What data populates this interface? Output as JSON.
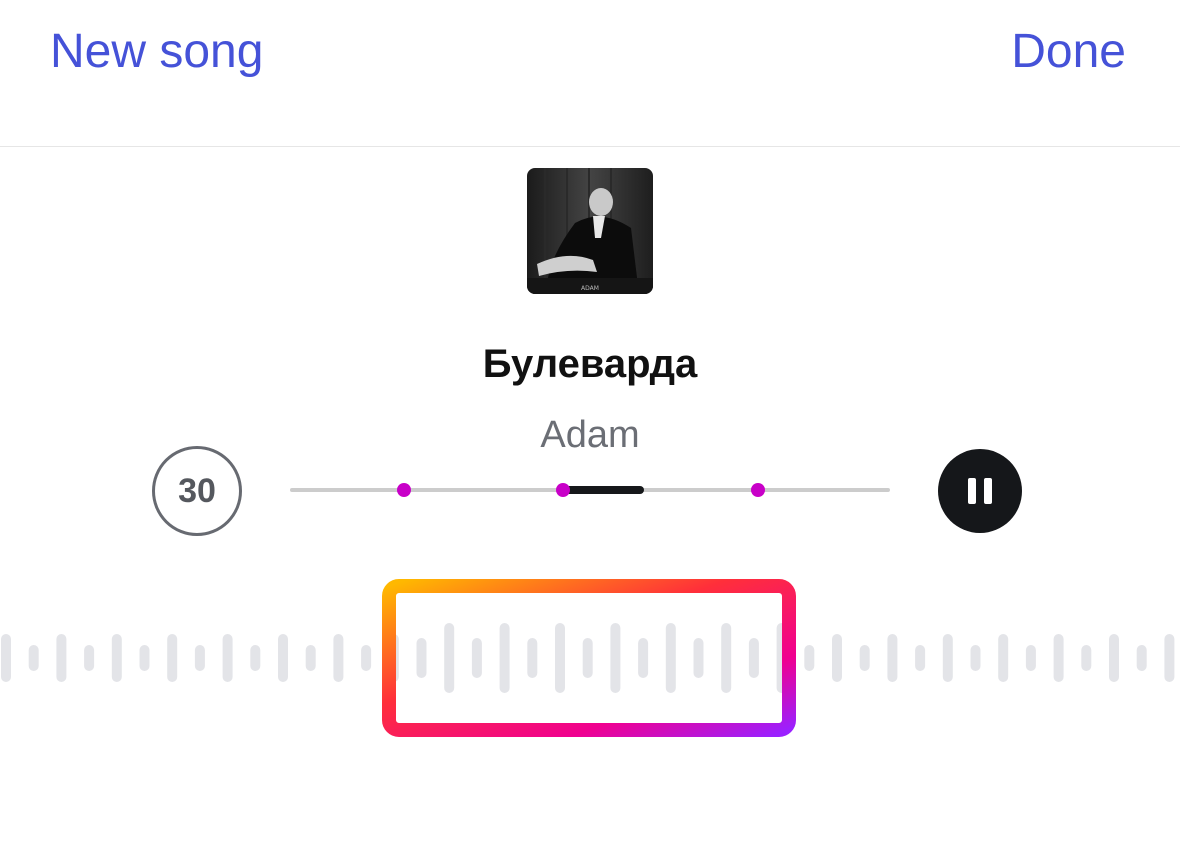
{
  "header": {
    "left_action": "New song",
    "right_action": "Done"
  },
  "track": {
    "title": "Булеварда",
    "artist": "Adam",
    "cover_caption": "ADAM"
  },
  "controls": {
    "clip_duration": "30",
    "play_state_icon": "pause-icon",
    "timeline_markers": [
      0.19,
      0.455,
      0.78
    ],
    "selected_range": [
      0.455,
      0.59
    ]
  },
  "colors": {
    "accent": "#4552d8",
    "marker": "#c800c8",
    "selection_gradient": [
      "#ffb800",
      "#ff2f3a",
      "#f00090",
      "#9b20ff"
    ]
  }
}
